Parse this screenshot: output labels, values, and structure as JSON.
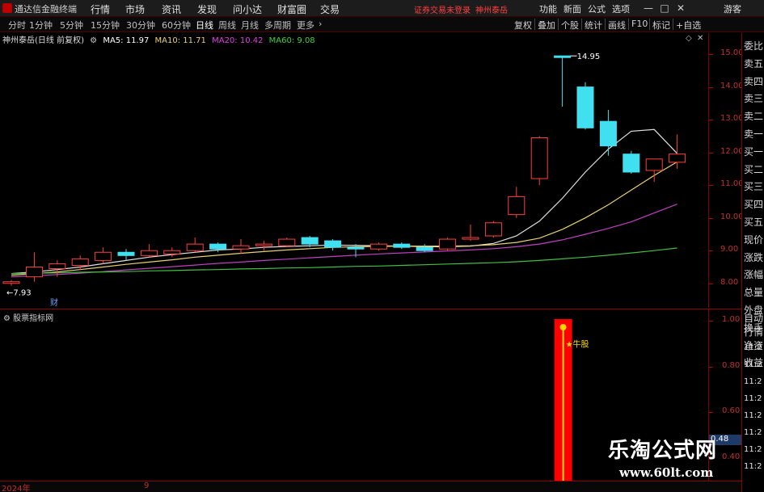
{
  "window": {
    "app_title": "通达信金融终端",
    "menu": [
      "行情",
      "市场",
      "资讯",
      "发现",
      "问小达",
      "财富圈",
      "交易"
    ],
    "warn_text": "证券交易未登录",
    "stock_link": "神州泰岳",
    "right_menu": [
      "功能",
      "新面",
      "公式",
      "选项",
      "游客"
    ],
    "win_buttons": [
      "—",
      "□",
      "✕"
    ]
  },
  "toolbar": {
    "periods": [
      "分时",
      "1分钟",
      "5分钟",
      "15分钟",
      "30分钟",
      "60分钟",
      "日线",
      "周线",
      "月线",
      "多周期",
      "更多"
    ],
    "active_period": "日线",
    "right_buttons": [
      "复权",
      "叠加",
      "个股",
      "统计",
      "画线",
      "F10",
      "标记",
      "+自选"
    ]
  },
  "chart_header": {
    "stock": "神州泰岳(日线 前复权)",
    "ma": [
      {
        "label": "MA5: 11.97",
        "color": "#ffffff"
      },
      {
        "label": "MA10: 11.71",
        "color": "#e8d070"
      },
      {
        "label": "MA20: 10.42",
        "color": "#e040e0"
      },
      {
        "label": "MA60: 9.08",
        "color": "#40d040"
      }
    ]
  },
  "annotations": {
    "high": "14.95",
    "low": "7.93",
    "cai_marker": "财"
  },
  "indicator": {
    "title": "股票指标网",
    "signal": "牛股",
    "value_label": "0.48",
    "y_ticks": [
      "1.00",
      "0.80",
      "0.60",
      "0.40"
    ]
  },
  "right_panel": {
    "top": [
      "委比",
      "卖五",
      "卖四",
      "卖三",
      "卖二",
      "卖一",
      "买一",
      "买二",
      "买三",
      "买四",
      "买五",
      "现价",
      "涨跌",
      "涨幅",
      "总量",
      "外盘",
      "换手",
      "净资",
      "收益"
    ],
    "bottom": [
      "自动",
      "行情"
    ],
    "times": [
      "11:2",
      "11:2",
      "11:2",
      "11:2",
      "11:2",
      "11:2",
      "11:2",
      "11:2"
    ]
  },
  "bottom_bar": {
    "year": "2024年",
    "tick": "9"
  },
  "watermark": {
    "title": "乐淘公式网",
    "url": "www.60lt.com"
  },
  "colors": {
    "up": "#ff4040",
    "down": "#40e0f0",
    "axis": "#b00000",
    "signal": "#ff0000",
    "signal_line": "#ffd700"
  },
  "chart_data": {
    "type": "candlestick",
    "y_ticks": [
      8.0,
      9.0,
      10.0,
      11.0,
      12.0,
      13.0,
      14.0,
      15.0
    ],
    "ylim": [
      7.5,
      15.3
    ],
    "candles": [
      {
        "o": 8.0,
        "h": 8.1,
        "l": 7.93,
        "c": 8.05
      },
      {
        "o": 8.2,
        "h": 8.95,
        "l": 8.05,
        "c": 8.5
      },
      {
        "o": 8.45,
        "h": 8.7,
        "l": 8.2,
        "c": 8.6
      },
      {
        "o": 8.55,
        "h": 8.85,
        "l": 8.4,
        "c": 8.75
      },
      {
        "o": 8.7,
        "h": 9.1,
        "l": 8.6,
        "c": 8.95
      },
      {
        "o": 8.95,
        "h": 9.05,
        "l": 8.7,
        "c": 8.85
      },
      {
        "o": 8.85,
        "h": 9.2,
        "l": 8.8,
        "c": 9.0
      },
      {
        "o": 8.9,
        "h": 9.1,
        "l": 8.8,
        "c": 9.0
      },
      {
        "o": 9.0,
        "h": 9.4,
        "l": 8.95,
        "c": 9.2
      },
      {
        "o": 9.2,
        "h": 9.25,
        "l": 8.95,
        "c": 9.05
      },
      {
        "o": 9.05,
        "h": 9.35,
        "l": 8.9,
        "c": 9.15
      },
      {
        "o": 9.15,
        "h": 9.3,
        "l": 9.0,
        "c": 9.2
      },
      {
        "o": 9.15,
        "h": 9.4,
        "l": 9.1,
        "c": 9.35
      },
      {
        "o": 9.4,
        "h": 9.45,
        "l": 9.1,
        "c": 9.2
      },
      {
        "o": 9.3,
        "h": 9.35,
        "l": 9.0,
        "c": 9.1
      },
      {
        "o": 9.1,
        "h": 9.2,
        "l": 8.8,
        "c": 9.05
      },
      {
        "o": 9.05,
        "h": 9.25,
        "l": 9.0,
        "c": 9.2
      },
      {
        "o": 9.2,
        "h": 9.25,
        "l": 9.05,
        "c": 9.1
      },
      {
        "o": 9.1,
        "h": 9.2,
        "l": 8.95,
        "c": 9.0
      },
      {
        "o": 9.05,
        "h": 9.4,
        "l": 9.0,
        "c": 9.35
      },
      {
        "o": 9.35,
        "h": 9.8,
        "l": 9.3,
        "c": 9.4
      },
      {
        "o": 9.45,
        "h": 9.9,
        "l": 9.4,
        "c": 9.85
      },
      {
        "o": 10.1,
        "h": 10.95,
        "l": 10.0,
        "c": 10.65
      },
      {
        "o": 11.2,
        "h": 12.5,
        "l": 11.0,
        "c": 12.45
      },
      {
        "o": 14.95,
        "h": 14.95,
        "l": 13.4,
        "c": 14.9
      },
      {
        "o": 14.0,
        "h": 14.15,
        "l": 12.7,
        "c": 12.75
      },
      {
        "o": 12.95,
        "h": 13.3,
        "l": 11.9,
        "c": 12.2
      },
      {
        "o": 11.95,
        "h": 12.05,
        "l": 11.35,
        "c": 11.4
      },
      {
        "o": 11.45,
        "h": 11.8,
        "l": 11.1,
        "c": 11.8
      },
      {
        "o": 11.7,
        "h": 12.55,
        "l": 11.5,
        "c": 11.95
      }
    ],
    "ma_series": [
      {
        "name": "MA5",
        "values": [
          8.3,
          8.35,
          8.42,
          8.5,
          8.6,
          8.7,
          8.8,
          8.88,
          8.95,
          9.02,
          9.05,
          9.1,
          9.13,
          9.15,
          9.17,
          9.16,
          9.15,
          9.14,
          9.12,
          9.12,
          9.14,
          9.22,
          9.45,
          9.9,
          10.6,
          11.4,
          12.1,
          12.65,
          12.7,
          11.97
        ]
      },
      {
        "name": "MA10",
        "values": [
          8.25,
          8.3,
          8.35,
          8.42,
          8.5,
          8.58,
          8.65,
          8.72,
          8.8,
          8.86,
          8.92,
          8.97,
          9.02,
          9.06,
          9.1,
          9.12,
          9.13,
          9.14,
          9.14,
          9.14,
          9.15,
          9.18,
          9.25,
          9.38,
          9.65,
          10.0,
          10.4,
          10.85,
          11.3,
          11.71
        ]
      },
      {
        "name": "MA20",
        "values": [
          8.2,
          8.23,
          8.27,
          8.31,
          8.36,
          8.41,
          8.46,
          8.51,
          8.56,
          8.61,
          8.65,
          8.7,
          8.74,
          8.78,
          8.82,
          8.86,
          8.9,
          8.93,
          8.96,
          8.99,
          9.02,
          9.06,
          9.12,
          9.2,
          9.33,
          9.5,
          9.68,
          9.88,
          10.15,
          10.42
        ]
      },
      {
        "name": "MA60",
        "values": [
          8.3,
          8.31,
          8.32,
          8.34,
          8.35,
          8.36,
          8.38,
          8.39,
          8.41,
          8.42,
          8.44,
          8.45,
          8.47,
          8.48,
          8.5,
          8.52,
          8.53,
          8.55,
          8.57,
          8.59,
          8.61,
          8.63,
          8.66,
          8.7,
          8.75,
          8.8,
          8.86,
          8.93,
          9.0,
          9.08
        ]
      }
    ]
  }
}
